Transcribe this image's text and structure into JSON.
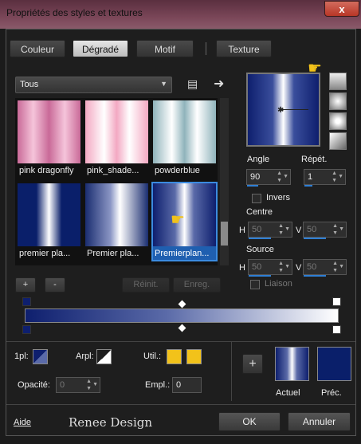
{
  "window": {
    "title": "Propriétés des styles et textures",
    "close_label": "x"
  },
  "tabs": [
    {
      "label": "Couleur",
      "active": false
    },
    {
      "label": "Dégradé",
      "active": true
    },
    {
      "label": "Motif",
      "active": false
    },
    {
      "label": "Texture",
      "active": false
    }
  ],
  "library": {
    "category": "Tous",
    "items": [
      {
        "label": "pink dragonfly",
        "colors": [
          "#c96a98",
          "#f5c4da",
          "#c96a98"
        ]
      },
      {
        "label": "pink_shade...",
        "colors": [
          "#f3a8c2",
          "#ffffff",
          "#f3a8c2"
        ]
      },
      {
        "label": "powderblue",
        "colors": [
          "#8fb3bb",
          "#ffffff",
          "#8fb3bb"
        ]
      },
      {
        "label": "premier pla...",
        "colors": [
          "#0a1f6a",
          "#ffffff",
          "#0a1f6a"
        ]
      },
      {
        "label": "Premier pla...",
        "colors": [
          "#1a2d70",
          "#ffffff",
          "#1a2d70"
        ]
      },
      {
        "label": "Premierplan...",
        "colors": [
          "#0e1f6e",
          "#ffffff",
          "#0e1f6e"
        ]
      }
    ]
  },
  "buttons": {
    "add": "+",
    "remove": "-",
    "reset": "Réinit.",
    "save": "Enreg."
  },
  "params": {
    "angle_label": "Angle",
    "angle": "90",
    "repeat_label": "Répét.",
    "repeat": "1",
    "invert_label": "Invers",
    "center_label": "Centre",
    "center_h_label": "H",
    "center_h": "50",
    "center_v_label": "V",
    "center_v": "50",
    "source_label": "Source",
    "source_h_label": "H",
    "source_h": "50",
    "source_v_label": "V",
    "source_v": "50",
    "link_label": "Liaison"
  },
  "editor": {
    "fg_label": "1pl:",
    "bg_label": "Arpl:",
    "user_label": "Util.:",
    "user_color": "#f2c21a",
    "opacity_label": "Opacité:",
    "opacity": "0",
    "location_label": "Empl.:",
    "location": "0"
  },
  "footer": {
    "current_label": "Actuel",
    "previous_label": "Préc.",
    "help": "Aide",
    "ok": "OK",
    "cancel": "Annuler",
    "watermark": "Renee Design"
  },
  "colors": {
    "navy": "#0e1f6e",
    "accent": "#2f7fd4",
    "hand": "#f2c21a"
  }
}
